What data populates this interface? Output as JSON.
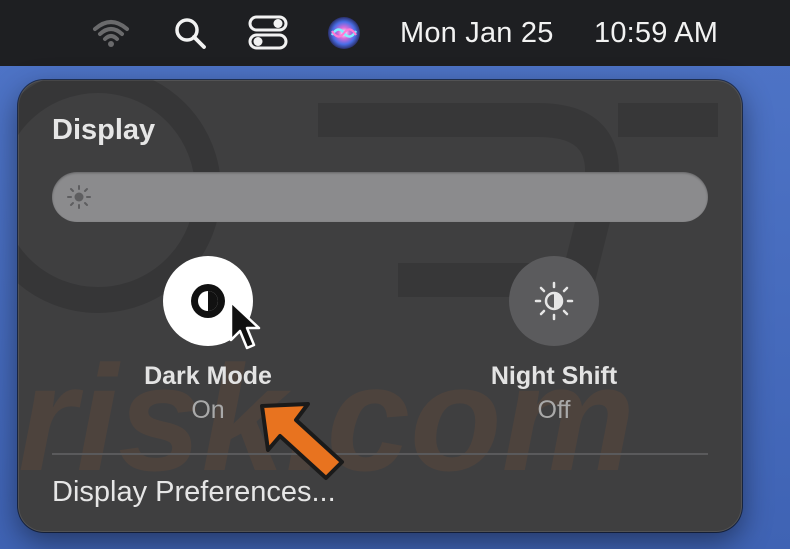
{
  "menubar": {
    "icons": [
      "wifi-icon",
      "search-icon",
      "control-center-icon",
      "siri-icon"
    ],
    "date": "Mon Jan 25",
    "time": "10:59 AM"
  },
  "display_panel": {
    "title": "Display",
    "brightness_icon": "sun-icon",
    "dark_mode": {
      "label": "Dark Mode",
      "state": "On",
      "icon": "dark-mode-icon"
    },
    "night_shift": {
      "label": "Night Shift",
      "state": "Off",
      "icon": "night-shift-icon"
    },
    "preferences_link": "Display Preferences..."
  },
  "colors": {
    "menubar_bg": "#1e1f22",
    "panel_bg": "#3f3f40",
    "desktop_bg": "#4a6fc0",
    "annotation_arrow": "#e8731f"
  }
}
